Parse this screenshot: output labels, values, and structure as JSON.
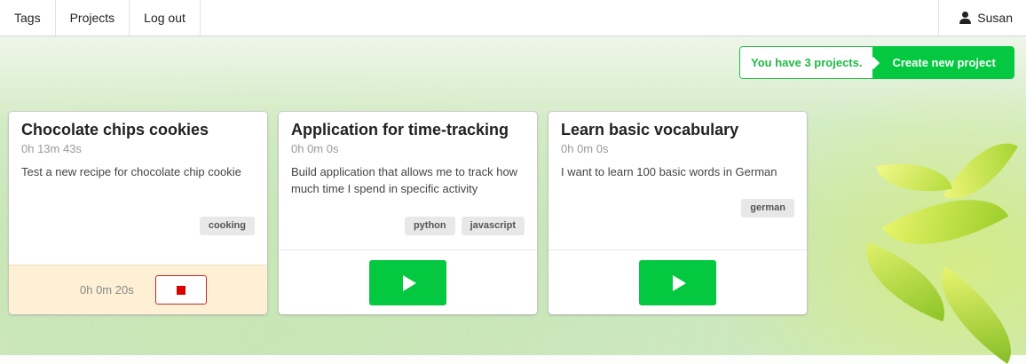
{
  "nav": {
    "items": [
      {
        "label": "Tags"
      },
      {
        "label": "Projects"
      },
      {
        "label": "Log out"
      }
    ],
    "user": {
      "name": "Susan",
      "icon": "user-icon"
    }
  },
  "projects_bar": {
    "count_text": "You have 3 projects.",
    "create_label": "Create new project"
  },
  "colors": {
    "accent_green": "#03c840",
    "count_green": "#21ba45",
    "stop_red": "#db0000",
    "running_bg": "#fdf0d5"
  },
  "cards": [
    {
      "title": "Chocolate chips cookies",
      "total_time": "0h 13m 43s",
      "description": "Test a new recipe for chocolate chip cookie",
      "tags": [
        "cooking"
      ],
      "state": "running",
      "running_time": "0h 0m 20s",
      "action_icon": "stop-icon"
    },
    {
      "title": "Application for time-tracking",
      "total_time": "0h 0m 0s",
      "description": "Build application that allows me to track how much time I spend in specific activity",
      "tags": [
        "python",
        "javascript"
      ],
      "state": "stopped",
      "action_icon": "play-icon"
    },
    {
      "title": "Learn basic vocabulary",
      "total_time": "0h 0m 0s",
      "description": "I want to learn 100 basic words in German",
      "tags": [
        "german"
      ],
      "state": "stopped",
      "action_icon": "play-icon"
    }
  ]
}
